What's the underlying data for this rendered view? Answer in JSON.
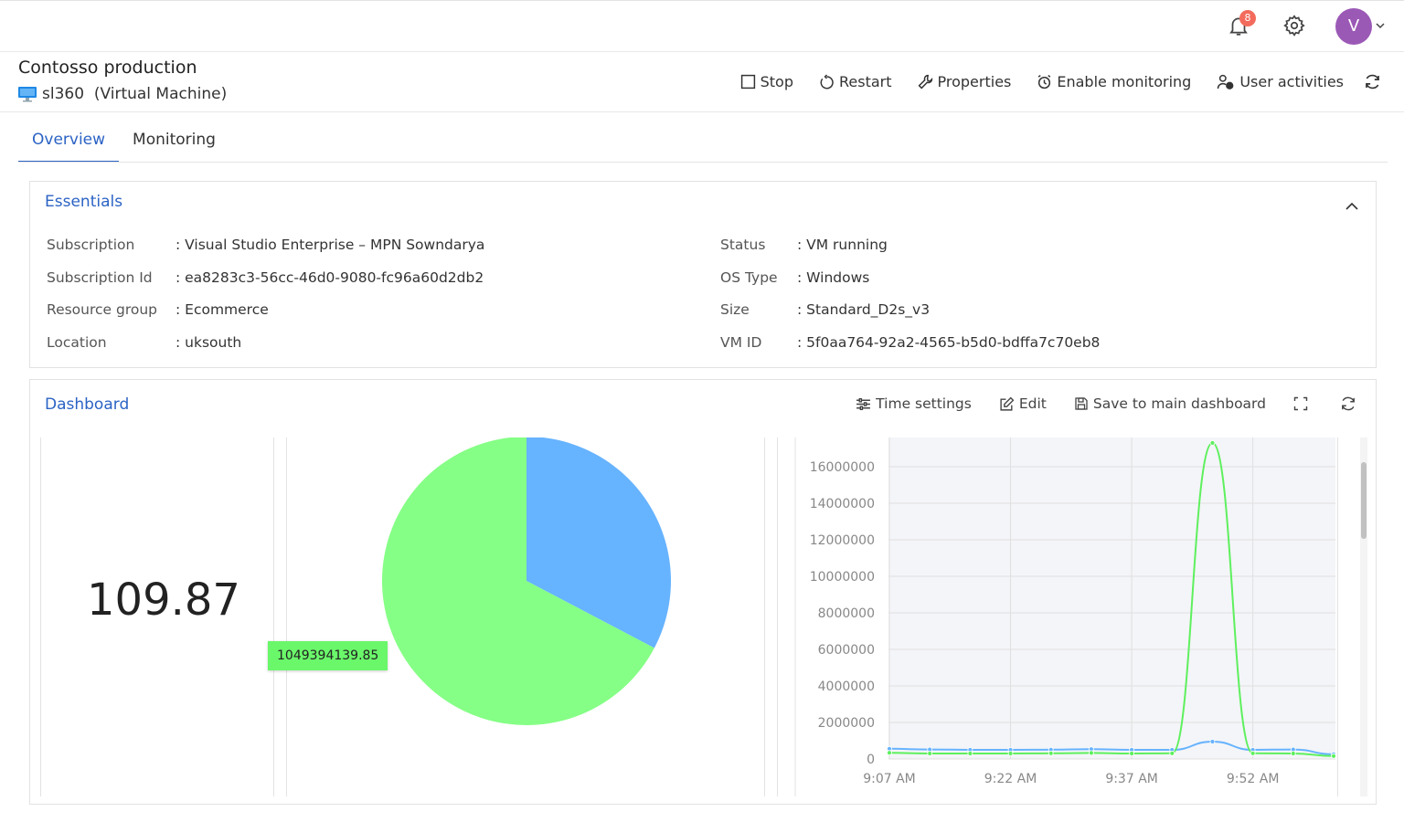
{
  "topbar": {
    "notification_count": "8",
    "avatar_initial": "V"
  },
  "header": {
    "title": "Contosso production",
    "vm_name": "sl360",
    "vm_type": "(Virtual Machine)"
  },
  "toolbar": {
    "stop": "Stop",
    "restart": "Restart",
    "properties": "Properties",
    "enable_monitoring": "Enable monitoring",
    "user_activities": "User activities"
  },
  "tabs": [
    "Overview",
    "Monitoring"
  ],
  "essentials": {
    "title": "Essentials",
    "left": [
      {
        "label": "Subscription",
        "value": ": Visual Studio Enterprise – MPN Sowndarya"
      },
      {
        "label": "Subscription Id",
        "value": ": ea8283c3-56cc-46d0-9080-fc96a60d2db2"
      },
      {
        "label": "Resource group",
        "value": ": Ecommerce"
      },
      {
        "label": "Location",
        "value": ": uksouth"
      }
    ],
    "right": [
      {
        "label": "Status",
        "value": ": VM running"
      },
      {
        "label": "OS Type",
        "value": ": Windows"
      },
      {
        "label": "Size",
        "value": ": Standard_D2s_v3"
      },
      {
        "label": "VM ID",
        "value": ": 5f0aa764-92a2-4565-b5d0-bdffa7c70eb8"
      }
    ]
  },
  "dashboard": {
    "title": "Dashboard",
    "time_settings": "Time settings",
    "edit": "Edit",
    "save": "Save to main dashboard",
    "metric_value": "109.87",
    "pie_tooltip": "1049394139.85"
  },
  "colors": {
    "accent": "#2b63c4",
    "series_blue": "#66b3ff",
    "series_green": "#85ff85",
    "line_green": "#5ef05e",
    "badge": "#f36b5c",
    "avatar": "#9b59b6"
  },
  "chart_data": [
    {
      "type": "pie",
      "slices": [
        {
          "color": "#66b3ff",
          "value": 0.327
        },
        {
          "color": "#85ff85",
          "value": 0.673
        }
      ],
      "tooltip": "1049394139.85"
    },
    {
      "type": "line",
      "x_ticks": [
        "9:07 AM",
        "9:22 AM",
        "9:37 AM",
        "9:52 AM"
      ],
      "y_ticks": [
        "0",
        "2000000",
        "4000000",
        "6000000",
        "8000000",
        "10000000",
        "12000000",
        "14000000",
        "16000000"
      ],
      "ylim": [
        0,
        17200000
      ],
      "grid": true,
      "x_minutes": [
        0,
        5,
        10,
        15,
        20,
        25,
        30,
        35,
        40,
        45,
        50,
        55
      ],
      "series": [
        {
          "color": "#66b3ff",
          "values": [
            560000,
            520000,
            500000,
            500000,
            510000,
            540000,
            500000,
            500000,
            950000,
            500000,
            520000,
            260000
          ]
        },
        {
          "color": "#5ef05e",
          "values": [
            340000,
            300000,
            300000,
            300000,
            310000,
            330000,
            300000,
            310000,
            17300000,
            310000,
            300000,
            160000
          ]
        }
      ]
    }
  ]
}
